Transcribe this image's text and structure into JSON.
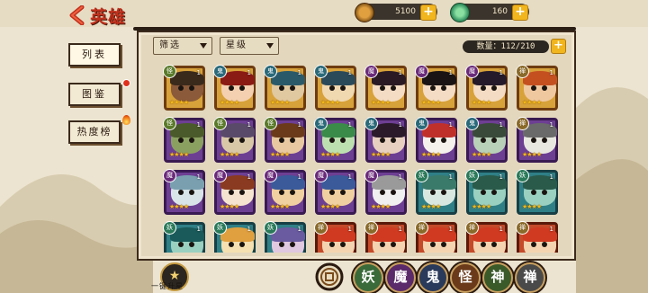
{
  "header": {
    "title": "英雄",
    "coins": "5100",
    "jade": "160"
  },
  "tabs": [
    {
      "label": "列表",
      "active": true
    },
    {
      "label": "图鉴",
      "badge": "red-dot"
    },
    {
      "label": "热度榜",
      "badge": "flame"
    }
  ],
  "filters": {
    "filter_label": "筛选",
    "star_label": "星级"
  },
  "count_text": "数量：112/210",
  "bottom": {
    "star_up_label": "一键升星",
    "factions": [
      "妖",
      "魔",
      "鬼",
      "怪",
      "神",
      "禅"
    ]
  },
  "cards": [
    {
      "tag": "怪",
      "level": "1",
      "tier": "gold",
      "stars": "★★★★",
      "colors": [
        "#8a5a3a",
        "#3a2a1c"
      ]
    },
    {
      "tag": "鬼",
      "level": "1",
      "tier": "gold",
      "stars": "★★★★",
      "colors": [
        "#f4d0b0",
        "#8a1a14"
      ]
    },
    {
      "tag": "鬼",
      "level": "1",
      "tier": "gold",
      "stars": "★★★★",
      "colors": [
        "#e0c8a0",
        "#2a5a6a"
      ]
    },
    {
      "tag": "鬼",
      "level": "1",
      "tier": "gold",
      "stars": "★★★★",
      "colors": [
        "#f0d8b0",
        "#2a4a5a"
      ]
    },
    {
      "tag": "魔",
      "level": "1",
      "tier": "gold",
      "stars": "★★★★",
      "colors": [
        "#f4dcc4",
        "#2a1a24"
      ]
    },
    {
      "tag": "魔",
      "level": "1",
      "tier": "gold",
      "stars": "★★★★",
      "colors": [
        "#f4dcc4",
        "#1a1414"
      ]
    },
    {
      "tag": "魔",
      "level": "1",
      "tier": "gold",
      "stars": "★★★★",
      "colors": [
        "#f4dcc4",
        "#241a2a"
      ]
    },
    {
      "tag": "禅",
      "level": "1",
      "tier": "gold",
      "stars": "★★★★",
      "colors": [
        "#f0c8a0",
        "#c45020"
      ]
    },
    {
      "tag": "怪",
      "level": "1",
      "tier": "purple",
      "stars": "★★★★",
      "colors": [
        "#8aa060",
        "#4a5a2a"
      ]
    },
    {
      "tag": "怪",
      "level": "1",
      "tier": "purple",
      "stars": "★★★★",
      "colors": [
        "#d8c8a8",
        "#5a4a6a"
      ]
    },
    {
      "tag": "怪",
      "level": "1",
      "tier": "purple",
      "stars": "★★★★",
      "colors": [
        "#e8c8a0",
        "#6a3a1a"
      ]
    },
    {
      "tag": "鬼",
      "level": "1",
      "tier": "purple",
      "stars": "★★★★",
      "colors": [
        "#bde0b0",
        "#3a8a4a"
      ]
    },
    {
      "tag": "鬼",
      "level": "1",
      "tier": "purple",
      "stars": "★★★★",
      "colors": [
        "#e8d0c0",
        "#2a1a2a"
      ]
    },
    {
      "tag": "鬼",
      "level": "1",
      "tier": "purple",
      "stars": "★★★★",
      "colors": [
        "#f4f0ec",
        "#c0302a"
      ]
    },
    {
      "tag": "鬼",
      "level": "1",
      "tier": "purple",
      "stars": "★★★★",
      "colors": [
        "#b8d0b8",
        "#3a4a3a"
      ]
    },
    {
      "tag": "禅",
      "level": "1",
      "tier": "purple",
      "stars": "★★★★",
      "colors": [
        "#e8e8e0",
        "#6a6a6a"
      ]
    },
    {
      "tag": "魔",
      "level": "1",
      "tier": "purple",
      "stars": "★★★★",
      "colors": [
        "#d8e4e8",
        "#7aa0b0"
      ]
    },
    {
      "tag": "魔",
      "level": "1",
      "tier": "purple",
      "stars": "★★★★",
      "colors": [
        "#f4e4d0",
        "#8a3a20"
      ]
    },
    {
      "tag": "魔",
      "level": "1",
      "tier": "purple",
      "stars": "★★★★",
      "colors": [
        "#f0d0a0",
        "#3a5a9a"
      ]
    },
    {
      "tag": "魔",
      "level": "1",
      "tier": "purple",
      "stars": "★★★★",
      "colors": [
        "#f0d0a0",
        "#3a5a9a"
      ]
    },
    {
      "tag": "魔",
      "level": "1",
      "tier": "purple",
      "stars": "★★★★",
      "colors": [
        "#f0f0f0",
        "#9a9a9a"
      ]
    },
    {
      "tag": "妖",
      "level": "1",
      "tier": "teal",
      "stars": "★★★★",
      "colors": [
        "#d8e8e0",
        "#3a7a6a"
      ]
    },
    {
      "tag": "妖",
      "level": "1",
      "tier": "teal",
      "stars": "★★★★",
      "colors": [
        "#9ad0c0",
        "#2a5a4a"
      ]
    },
    {
      "tag": "妖",
      "level": "1",
      "tier": "teal",
      "stars": "★★★★",
      "colors": [
        "#9ad0c0",
        "#2a5a4a"
      ]
    },
    {
      "tag": "妖",
      "level": "1",
      "tier": "teal",
      "stars": "★★★★",
      "colors": [
        "#9ad0c0",
        "#1a5a5a"
      ]
    },
    {
      "tag": "妖",
      "level": "1",
      "tier": "teal",
      "stars": "★★★★",
      "colors": [
        "#f4e0b0",
        "#e0a040"
      ]
    },
    {
      "tag": "妖",
      "level": "1",
      "tier": "teal",
      "stars": "★★★★",
      "colors": [
        "#e0c8e0",
        "#6a5aa0"
      ]
    },
    {
      "tag": "禅",
      "level": "1",
      "tier": "red",
      "stars": "★★★★",
      "colors": [
        "#f4d4b0",
        "#d03a20"
      ]
    },
    {
      "tag": "禅",
      "level": "1",
      "tier": "red",
      "stars": "★★★★",
      "colors": [
        "#f4d4b0",
        "#d03a20"
      ]
    },
    {
      "tag": "禅",
      "level": "1",
      "tier": "red",
      "stars": "★★★★",
      "colors": [
        "#f4d4b0",
        "#d03a20"
      ]
    },
    {
      "tag": "禅",
      "level": "1",
      "tier": "red",
      "stars": "★★★★",
      "colors": [
        "#f4d4b0",
        "#d03a20"
      ]
    },
    {
      "tag": "禅",
      "level": "1",
      "tier": "red",
      "stars": "★★★★",
      "colors": [
        "#f4d4b0",
        "#d03a20"
      ]
    }
  ],
  "tag_colors": {
    "怪": "#5a7a2a",
    "鬼": "#2a6a7a",
    "魔": "#6a2a7a",
    "禅": "#8a6a2a",
    "妖": "#2a7a5a"
  },
  "faction_colors": [
    "#3a6a3a",
    "#5a2a6a",
    "#2a3a5a",
    "#6a3a1a",
    "#3a5a2a",
    "#4a4a4a"
  ]
}
